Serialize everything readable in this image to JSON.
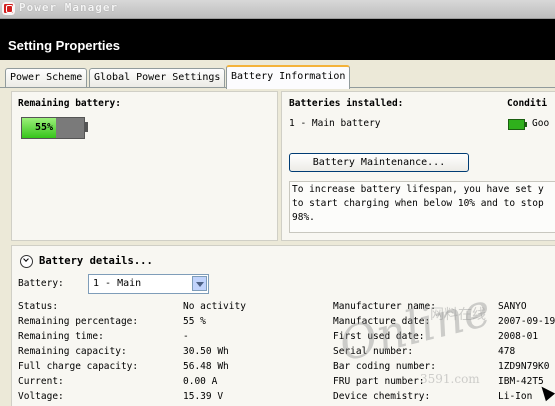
{
  "window": {
    "title": "Power Manager"
  },
  "header": {
    "title": "Setting Properties"
  },
  "tabs": [
    {
      "label": "Power Scheme"
    },
    {
      "label": "Global Power Settings"
    },
    {
      "label": "Battery Information"
    }
  ],
  "remaining": {
    "label": "Remaining battery:",
    "percent_text": "55%",
    "level": 0.55
  },
  "installed": {
    "label": "Batteries installed:",
    "item": "1 - Main battery"
  },
  "condition": {
    "label": "Conditi",
    "value": "Goo"
  },
  "maintenance_button": "Battery Maintenance...",
  "info_text": [
    "To increase battery lifespan, you have set y",
    "to start charging when below 10% and to stop",
    "98%."
  ],
  "details": {
    "heading": "Battery details...",
    "battery_label": "Battery:",
    "battery_selected": "1 - Main",
    "left_rows": [
      {
        "label": "Status:",
        "value": "No activity"
      },
      {
        "label": "Remaining percentage:",
        "value": "55 %"
      },
      {
        "label": "Remaining time:",
        "value": "-"
      },
      {
        "label": "Remaining capacity:",
        "value": "30.50 Wh"
      },
      {
        "label": "Full charge capacity:",
        "value": "56.48 Wh"
      },
      {
        "label": "Current:",
        "value": "0.00 A"
      },
      {
        "label": "Voltage:",
        "value": "15.39 V"
      }
    ],
    "right_rows": [
      {
        "label": "Manufacturer name:",
        "value": "SANYO"
      },
      {
        "label": "Manufacture date:",
        "value": "2007-09-19"
      },
      {
        "label": "First used date:",
        "value": "2008-01"
      },
      {
        "label": "Serial number:",
        "value": "478"
      },
      {
        "label": "Bar coding number:",
        "value": "1ZD9N79K0"
      },
      {
        "label": "FRU part number:",
        "value": "IBM-42T5"
      },
      {
        "label": "Device chemistry:",
        "value": "Li-Ion"
      }
    ]
  },
  "watermark": {
    "script": "Online",
    "chinese": "网料在线",
    "url": "3591.com"
  },
  "colors": {
    "battery_fill": "#36c41b",
    "active_tab_accent": "#f4b33a",
    "header_bg": "#000000"
  }
}
